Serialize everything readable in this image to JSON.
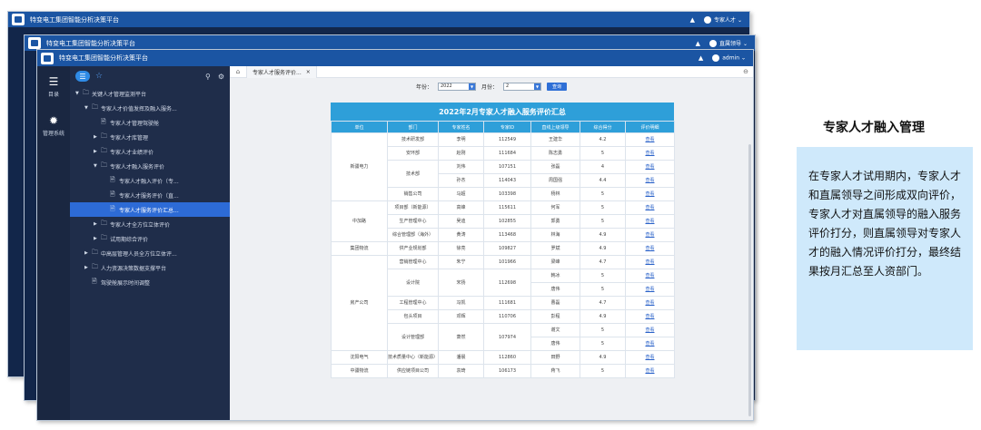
{
  "app_title": "特变电工集团智能分析决策平台",
  "windows": {
    "back1": {
      "user": "专家人才"
    },
    "back2": {
      "user": "直属领导"
    },
    "front": {
      "user": "admin"
    }
  },
  "rail": {
    "items": [
      {
        "icon": "grid-icon",
        "label": "目录"
      },
      {
        "icon": "gear-icon",
        "label": "管理系统"
      }
    ]
  },
  "sidebar": {
    "items": [
      {
        "label": "关键人才管理监测平台",
        "level": 0,
        "arrow": "▼"
      },
      {
        "label": "专家人才价值发挥及融入服务...",
        "level": 1,
        "arrow": "▼"
      },
      {
        "label": "专家人才管理驾驶舱",
        "level": 2,
        "arrow": ""
      },
      {
        "label": "专家人才库管理",
        "level": 2,
        "arrow": "▶"
      },
      {
        "label": "专家人才业绩评价",
        "level": 2,
        "arrow": "▶"
      },
      {
        "label": "专家人才融入服务评价",
        "level": 2,
        "arrow": "▼"
      },
      {
        "label": "专家人才融入评价（专...",
        "level": 3,
        "arrow": ""
      },
      {
        "label": "专家人才服务评价（直...",
        "level": 3,
        "arrow": ""
      },
      {
        "label": "专家人才服务评价汇总...",
        "level": 3,
        "arrow": "",
        "active": true
      },
      {
        "label": "专家人才全方位立体评价",
        "level": 2,
        "arrow": "▶"
      },
      {
        "label": "试用期综合评价",
        "level": 2,
        "arrow": "▶"
      },
      {
        "label": "中高层管理人员全方位立体评...",
        "level": 1,
        "arrow": "▶"
      },
      {
        "label": "人力资源决策数据支撑平台",
        "level": 1,
        "arrow": "▶"
      },
      {
        "label": "驾驶舱展示时间调整",
        "level": 1,
        "arrow": ""
      }
    ]
  },
  "tab": {
    "label": "专家人才服务评价..."
  },
  "filter": {
    "year_label": "年份：",
    "year_value": "2022",
    "month_label": "月份：",
    "month_value": "2",
    "query_label": "查询"
  },
  "table": {
    "title": "2022年2月专家人才融入服务评价汇总",
    "headers": [
      "单位",
      "部门",
      "专家姓名",
      "专家ID",
      "直线上级领导",
      "综合得分",
      "评价明细"
    ],
    "rows": [
      {
        "unit": "新疆电力",
        "unit_span": 5,
        "dept": "技术研发部",
        "dept_span": 1,
        "name": "李明",
        "id": "112549",
        "leader": "王建华",
        "score": "4.2",
        "view": "查看"
      },
      {
        "dept": "安环部",
        "dept_span": 1,
        "name": "赵刚",
        "id": "111684",
        "leader": "陈志勇",
        "score": "5",
        "view": "查看"
      },
      {
        "dept": "技术部",
        "dept_span": 2,
        "name": "刘伟",
        "id": "107151",
        "leader": "张磊",
        "score": "4",
        "view": "查看"
      },
      {
        "name": "孙杰",
        "id": "114043",
        "leader": "周国强",
        "score": "4.4",
        "view": "查看"
      },
      {
        "dept": "销售公司",
        "dept_span": 1,
        "name": "马超",
        "id": "103398",
        "leader": "杨林",
        "score": "5",
        "view": "查看"
      },
      {
        "unit": "中加路",
        "unit_span": 3,
        "dept": "项目部（新能源）",
        "dept_span": 1,
        "name": "高峰",
        "id": "115611",
        "leader": "何军",
        "score": "5",
        "view": "查看"
      },
      {
        "dept": "生产管理中心",
        "dept_span": 1,
        "name": "吴迪",
        "id": "102855",
        "leader": "郭勇",
        "score": "5",
        "view": "查看"
      },
      {
        "dept": "综合管理部（海外）",
        "dept_span": 1,
        "name": "黄涛",
        "id": "113468",
        "leader": "林海",
        "score": "4.9",
        "view": "查看"
      },
      {
        "unit": "集团物流",
        "unit_span": 1,
        "dept": "供产业规划部",
        "dept_span": 1,
        "name": "徐亮",
        "id": "109827",
        "leader": "罗斌",
        "score": "4.9",
        "view": "查看"
      },
      {
        "unit": "房产公司",
        "unit_span": 7,
        "dept": "营销管理中心",
        "dept_span": 1,
        "name": "朱宁",
        "id": "101966",
        "leader": "梁峰",
        "score": "4.7",
        "view": "查看"
      },
      {
        "dept": "设计院",
        "dept_span": 2,
        "name": "宋扬",
        "id": "112698",
        "leader": "韩冰",
        "score": "5",
        "view": "查看"
      },
      {
        "leader": "唐伟",
        "score": "5",
        "view": "查看"
      },
      {
        "dept": "工程管理中心",
        "dept_span": 1,
        "name": "冯凯",
        "id": "111681",
        "leader": "曹磊",
        "score": "4.7",
        "view": "查看"
      },
      {
        "dept": "包头项目",
        "dept_span": 1,
        "name": "邓辉",
        "id": "110706",
        "leader": "彭程",
        "score": "4.9",
        "view": "查看"
      },
      {
        "dept": "设计管理部",
        "dept_span": 2,
        "name": "萧然",
        "id": "107974",
        "leader": "谢文",
        "score": "5",
        "view": "查看"
      },
      {
        "leader": "唐伟",
        "score": "5",
        "view": "查看"
      },
      {
        "unit": "沈阳电气",
        "unit_span": 1,
        "dept": "技术质量中心（新能源）",
        "dept_span": 1,
        "name": "潘晨",
        "id": "112860",
        "leader": "田野",
        "score": "4.9",
        "view": "查看"
      },
      {
        "unit": "中疆物流",
        "unit_span": 1,
        "dept": "供应链项目公司",
        "dept_span": 1,
        "name": "袁琦",
        "id": "106173",
        "leader": "蒋飞",
        "score": "5",
        "view": "查看"
      }
    ]
  },
  "panel": {
    "title": "专家人才融入管理",
    "body": "在专家人才试用期内，专家人才和直属领导之间形成双向评价，专家人才对直属领导的融入服务评价打分，则直属领导对专家人才的融入情况评价打分，最终结果按月汇总至人资部门。"
  },
  "colors": {
    "title_bar": "#1b55a3",
    "sidebar": "#1f2d4a",
    "table_header": "#2e9fd9",
    "panel_bg": "#cfe9fb",
    "active_item": "#2d6bd6"
  }
}
